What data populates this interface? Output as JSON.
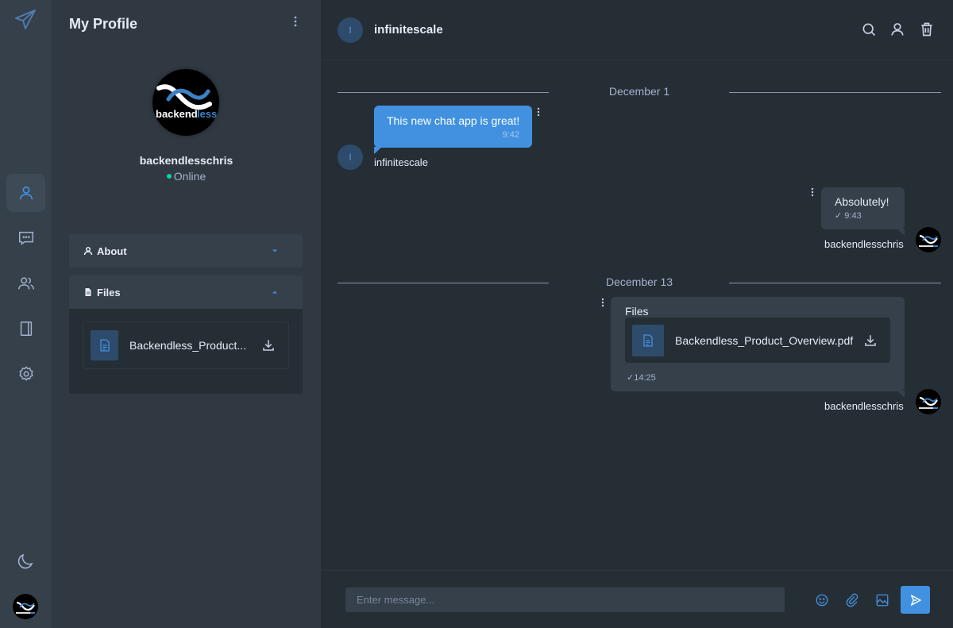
{
  "nav": {
    "items": [
      {
        "name": "profile",
        "icon": "user-icon",
        "active": true
      },
      {
        "name": "chats",
        "icon": "message-icon",
        "active": false
      },
      {
        "name": "groups",
        "icon": "users-icon",
        "active": false
      },
      {
        "name": "contacts",
        "icon": "book-icon",
        "active": false
      },
      {
        "name": "settings",
        "icon": "gear-icon",
        "active": false
      }
    ],
    "theme_icon": "moon-icon",
    "accent": "#4191e0"
  },
  "profile": {
    "title": "My Profile",
    "username": "backendlesschris",
    "status": "Online",
    "avatar_text": "backendless",
    "sections": {
      "about": {
        "label": "About",
        "expanded": false
      },
      "files": {
        "label": "Files",
        "expanded": true,
        "items": [
          {
            "name": "Backendless_Product..."
          }
        ]
      }
    }
  },
  "chat": {
    "contact_name": "infinitescale",
    "contact_initial": "I",
    "actions": [
      "search-icon",
      "user-icon",
      "trash-icon"
    ],
    "days": [
      {
        "label": "December 1"
      },
      {
        "label": "December 13"
      }
    ],
    "messages": [
      {
        "direction": "in",
        "text": "This new chat app is great!",
        "time": "9:42",
        "sender": "infinitescale"
      },
      {
        "direction": "out",
        "text": "Absolutely!",
        "time": "9:43",
        "sender": "backendlesschris"
      },
      {
        "direction": "out",
        "type": "files",
        "heading": "Files",
        "file_name": "Backendless_Product_Overview.pdf",
        "time": "14:25",
        "sender": "backendlesschris"
      }
    ]
  },
  "composer": {
    "placeholder": "Enter message...",
    "value": "",
    "buttons": [
      "emoji-icon",
      "attachment-icon",
      "image-icon",
      "send-icon"
    ]
  }
}
